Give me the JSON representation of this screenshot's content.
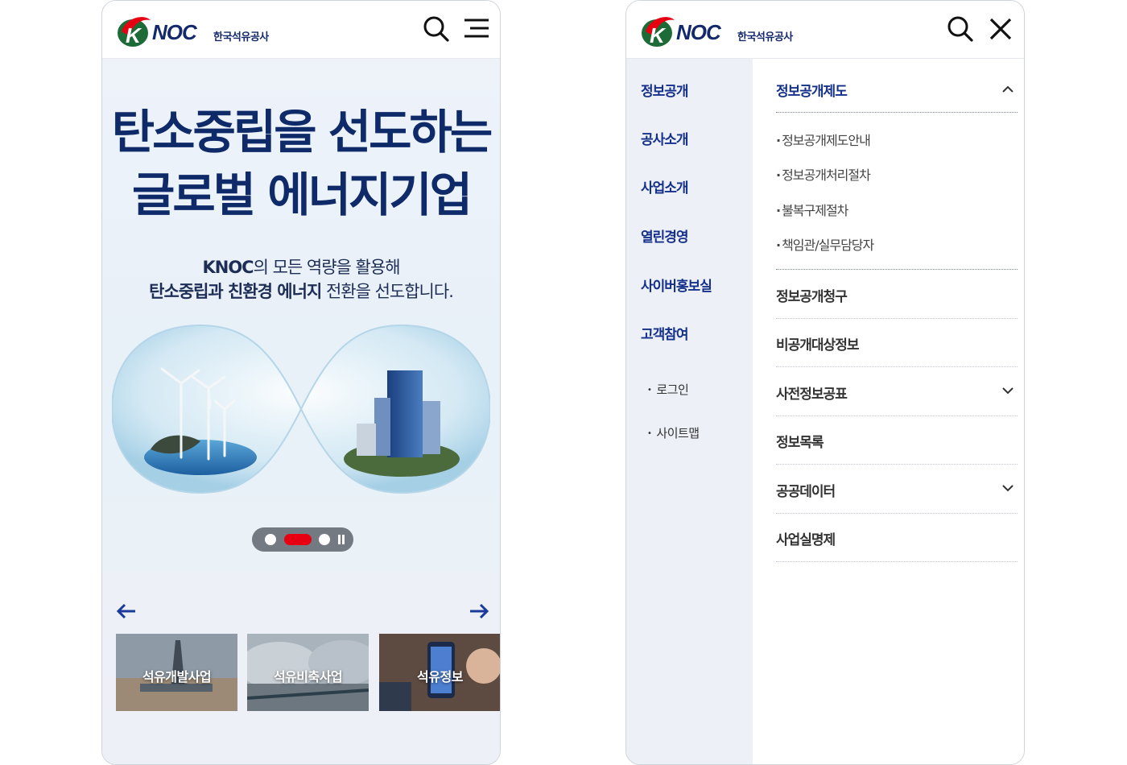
{
  "brand": {
    "logo_text": "NOC",
    "logo_sub": "한국석유공사",
    "red": "#e60012",
    "navy": "#14296b"
  },
  "left_screen": {
    "hero": {
      "title_line1": "탄소중립을 선도하는",
      "title_line2": "글로벌 에너지기업",
      "subtitle_line1_bold": "KNOC",
      "subtitle_line1_rest": "의 모든 역량을 활용해",
      "subtitle_line2_bold": "탄소중립과 친환경 에너지",
      "subtitle_line2_rest": " 전환을 선도합니다.",
      "slider": {
        "slides": 3,
        "current": 2
      }
    },
    "cards": [
      {
        "label": "석유개발사업"
      },
      {
        "label": "석유비축사업"
      },
      {
        "label": "석유정보"
      }
    ]
  },
  "right_screen": {
    "categories": [
      {
        "label": "정보공개"
      },
      {
        "label": "공사소개"
      },
      {
        "label": "사업소개"
      },
      {
        "label": "열린경영"
      },
      {
        "label": "사이버홍보실"
      },
      {
        "label": "고객참여"
      }
    ],
    "utilities": [
      {
        "label": "로그인"
      },
      {
        "label": "사이트맵"
      }
    ],
    "submenu": {
      "open_item": "정보공개제도",
      "open_children": [
        "정보공개제도안내",
        "정보공개처리절차",
        "불복구제절차",
        "책임관/실무담당자"
      ],
      "items": [
        {
          "label": "정보공개청구"
        },
        {
          "label": "비공개대상정보"
        },
        {
          "label": "사전정보공표"
        },
        {
          "label": "정보목록"
        },
        {
          "label": "공공데이터"
        },
        {
          "label": "사업실명제"
        }
      ]
    }
  }
}
